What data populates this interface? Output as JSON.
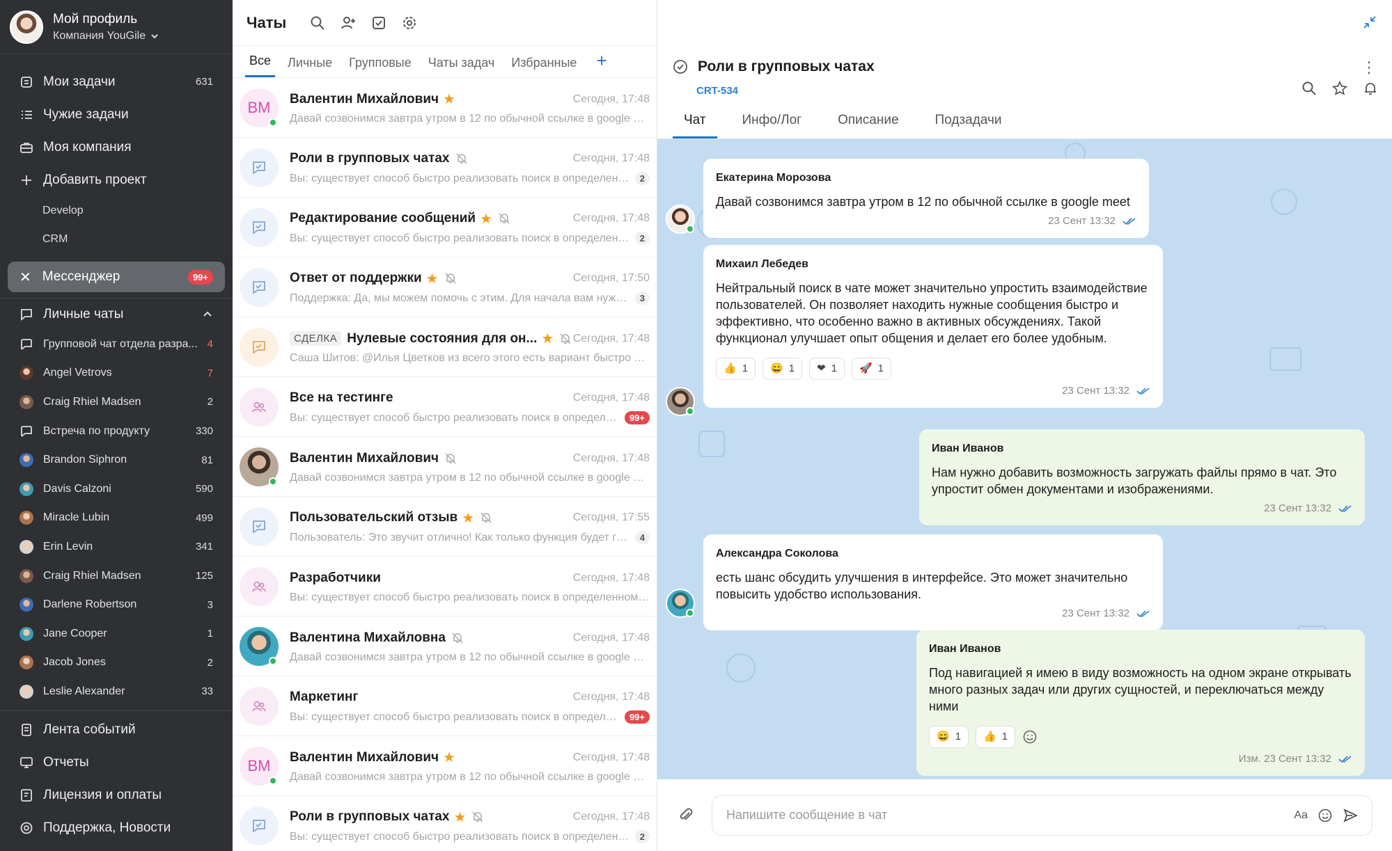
{
  "sidebar": {
    "profile_name": "Мой профиль",
    "company": "Компания YouGile",
    "nav": [
      {
        "label": "Мои задачи",
        "count": "631",
        "icon": "tasks-icon"
      },
      {
        "label": "Чужие задачи",
        "count": "",
        "icon": "list-icon"
      },
      {
        "label": "Моя компания",
        "count": "",
        "icon": "briefcase-icon"
      },
      {
        "label": "Добавить проект",
        "count": "",
        "icon": "plus-icon"
      }
    ],
    "projects": [
      "Develop",
      "CRM"
    ],
    "messenger": {
      "label": "Мессенджер",
      "badge": "99+"
    },
    "personal_chats_title": "Личные чаты",
    "personal_chats": [
      {
        "name": "Групповой чат отдела разра...",
        "count": "4"
      },
      {
        "name": "Angel Vetrovs",
        "count": "7"
      },
      {
        "name": "Craig Rhiel Madsen",
        "count": "2"
      },
      {
        "name": "Встреча по продукту",
        "count": "330"
      },
      {
        "name": "Brandon Siphron",
        "count": "81"
      },
      {
        "name": "Davis Calzoni",
        "count": "590"
      },
      {
        "name": "Miracle Lubin",
        "count": "499"
      },
      {
        "name": "Erin Levin",
        "count": "341"
      },
      {
        "name": "Craig Rhiel Madsen",
        "count": "125"
      },
      {
        "name": "Darlene Robertson",
        "count": "3"
      },
      {
        "name": "Jane Cooper",
        "count": "1"
      },
      {
        "name": "Jacob Jones",
        "count": "2"
      },
      {
        "name": "Leslie Alexander",
        "count": "33"
      }
    ],
    "bottom_nav": [
      "Лента событий",
      "Отчеты",
      "Лицензия и оплаты",
      "Поддержка, Новости"
    ]
  },
  "list": {
    "title": "Чаты",
    "tabs": [
      "Все",
      "Личные",
      "Групповые",
      "Чаты задач",
      "Избранные"
    ],
    "tab_add": "+",
    "chats": [
      {
        "name": "Валентин Михайлович",
        "time": "Сегодня, 17:48",
        "preview": "Давай созвонимся завтра утром в 12 по обычной ссылке в google meet",
        "unread": "",
        "avatar": "ВМ"
      },
      {
        "name": "Роли в групповых чатах",
        "time": "Сегодня, 17:48",
        "preview": "Вы: существует способ быстро реализовать поиск в определенн...",
        "unread": "2",
        "avatar": ""
      },
      {
        "name": "Редактирование сообщений",
        "time": "Сегодня, 17:48",
        "preview": "Вы: существует способ быстро реализовать поиск в определенн...",
        "unread": "2",
        "avatar": ""
      },
      {
        "name": "Ответ от поддержки",
        "time": "Сегодня, 17:50",
        "preview": "Поддержка: Да, мы можем помочь с этим. Для начала вам нужн...",
        "unread": "3",
        "avatar": ""
      },
      {
        "name": "Нулевые состояния для он...",
        "tag": "СДЕЛКА",
        "time": "Сегодня, 17:48",
        "preview": "Саша Шитов: @Илья Цветков из всего этого есть вариант быстро зат...",
        "unread": "",
        "avatar": ""
      },
      {
        "name": "Все на тестинге",
        "time": "Сегодня, 17:48",
        "preview": "Вы: существует способ быстро реализовать поиск в определе...",
        "unread": "99+",
        "avatar": ""
      },
      {
        "name": "Валентин Михайлович",
        "time": "Сегодня, 17:48",
        "preview": "Давай созвонимся завтра утром в 12 по обычной ссылке в google meet",
        "unread": "",
        "avatar": ""
      },
      {
        "name": "Пользовательский отзыв",
        "time": "Сегодня, 17:55",
        "preview": "Пользователь: Это звучит отлично! Как только функция будет го...",
        "unread": "4",
        "avatar": ""
      },
      {
        "name": "Разработчики",
        "time": "Сегодня, 17:48",
        "preview": "Вы: существует способ быстро реализовать поиск в определенном ч...",
        "unread": "",
        "avatar": ""
      },
      {
        "name": "Валентина Михайловна",
        "time": "Сегодня, 17:48",
        "preview": "Давай созвонимся завтра утром в 12 по обычной ссылке в google meet",
        "unread": "",
        "avatar": ""
      },
      {
        "name": "Маркетинг",
        "time": "Сегодня, 17:48",
        "preview": "Вы: существует способ быстро реализовать поиск в определе...",
        "unread": "99+",
        "avatar": ""
      },
      {
        "name": "Валентин Михайлович",
        "time": "Сегодня, 17:48",
        "preview": "Давай созвонимся завтра утром в 12 по обычной ссылке в google meet",
        "unread": "",
        "avatar": "ВМ"
      },
      {
        "name": "Роли в групповых чатах",
        "time": "Сегодня, 17:48",
        "preview": "Вы: существует способ быстро реализовать поиск в определенн...",
        "unread": "2",
        "avatar": ""
      }
    ]
  },
  "conversation": {
    "title": "Роли в групповых чатах",
    "code": "CRT-534",
    "tabs": [
      "Чат",
      "Инфо/Лог",
      "Описание",
      "Подзадачи"
    ],
    "messages": [
      {
        "author": "Екатерина Морозова",
        "text": "Давай созвонимся завтра утром в 12 по обычной ссылке в google meet",
        "time": "23 Сент 13:32"
      },
      {
        "author": "Михаил Лебедев",
        "text": "Нейтральный поиск в чате может значительно упростить взаимодействие пользователей. Он позволяет находить нужные сообщения быстро и эффективно, что особенно важно в активных обсуждениях. Такой функционал улучшает опыт общения и делает его более удобным.",
        "time": "23 Сент 13:32",
        "reactions": [
          "1",
          "1",
          "1",
          "1"
        ]
      },
      {
        "author": "Иван Иванов",
        "text": "Нам нужно добавить возможность загружать файлы прямо в чат. Это упростит обмен документами и изображениями.",
        "time": "23 Сент 13:32"
      },
      {
        "author": "Александра Соколова",
        "text": "есть шанс обсудить улучшения в интерфейсе. Это может значительно повысить удобство использования.",
        "time": "23 Сент 13:32"
      },
      {
        "author": "Иван Иванов",
        "text": "Под навигацией я имею в виду возможность на одном экране открывать много разных задач или других сущностей, и переключаться между ними",
        "time": "Изм. 23 Сент 13:32",
        "reactions": [
          "1",
          "1"
        ]
      }
    ],
    "composer_placeholder": "Напишите сообщение в чат",
    "format_label": "Aa"
  },
  "colors": {
    "accent": "#1f6fd1",
    "sidebar": "#2e3033",
    "unread_hot": "#e5484d",
    "star": "#f29c1b",
    "chat_bg": "#c3dcf2"
  }
}
